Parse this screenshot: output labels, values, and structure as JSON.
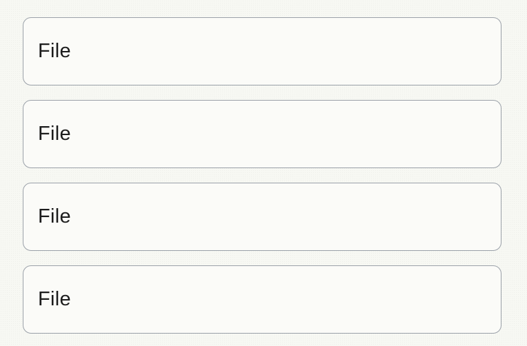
{
  "files": [
    {
      "label": "File"
    },
    {
      "label": "File"
    },
    {
      "label": "File"
    },
    {
      "label": "File"
    }
  ]
}
